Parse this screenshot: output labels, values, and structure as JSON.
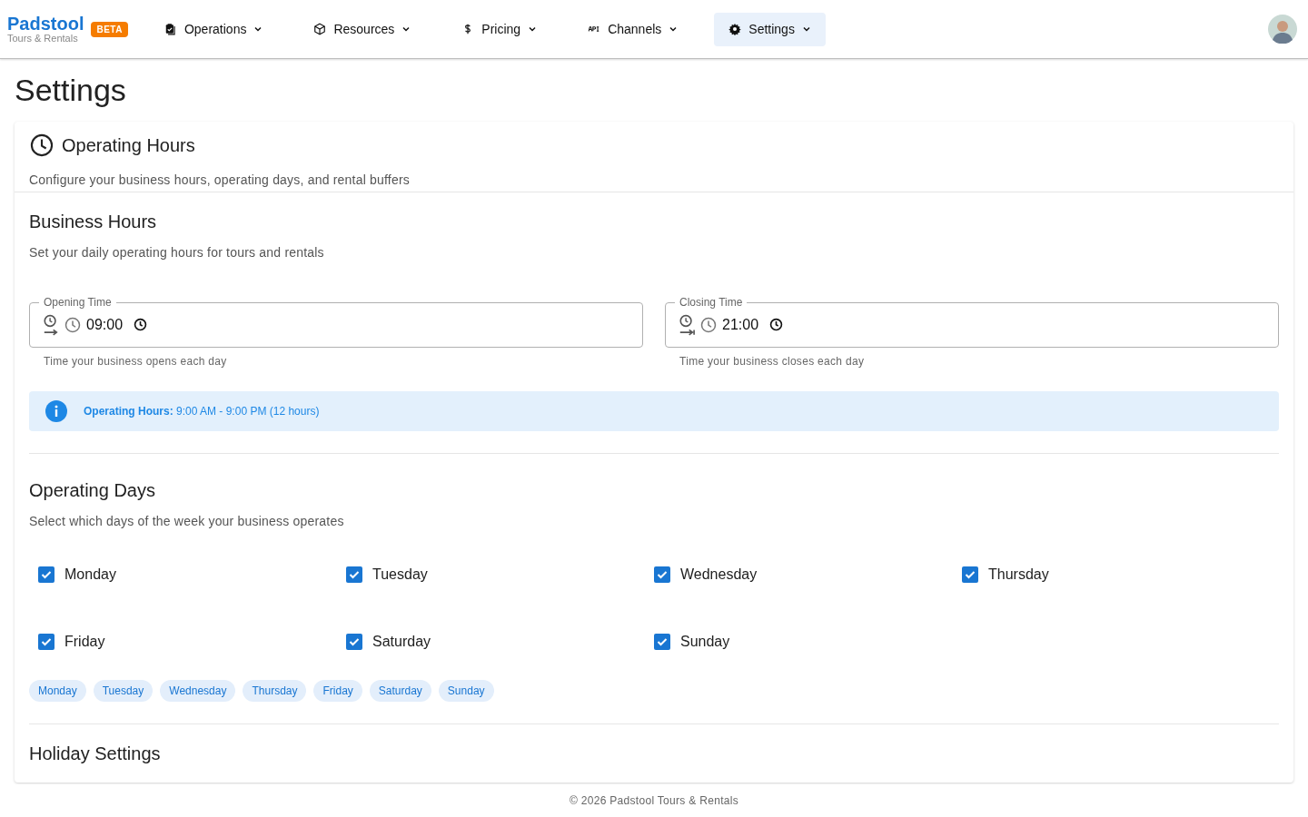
{
  "brand": {
    "name": "Padstool",
    "tagline": "Tours & Rentals",
    "badge": "BETA"
  },
  "nav": [
    {
      "label": "Operations",
      "selected": false
    },
    {
      "label": "Resources",
      "selected": false
    },
    {
      "label": "Pricing",
      "selected": false
    },
    {
      "label": "Channels",
      "selected": false
    },
    {
      "label": "Settings",
      "selected": true
    }
  ],
  "page_title": "Settings",
  "card": {
    "title": "Operating Hours",
    "subtitle": "Configure your business hours, operating days, and rental buffers"
  },
  "business_hours": {
    "title": "Business Hours",
    "subtitle": "Set your daily operating hours for tours and rentals",
    "fields": [
      {
        "kind": "open",
        "label": "Opening Time",
        "value": "09:00",
        "helper": "Time your business opens each day"
      },
      {
        "kind": "close",
        "label": "Closing Time",
        "value": "21:00",
        "helper": "Time your business closes each day"
      }
    ],
    "info": {
      "label": "Operating Hours:",
      "text": "9:00 AM - 9:00 PM (12 hours)"
    }
  },
  "operating_days": {
    "title": "Operating Days",
    "subtitle": "Select which days of the week your business operates",
    "days": [
      {
        "label": "Monday",
        "checked": true
      },
      {
        "label": "Tuesday",
        "checked": true
      },
      {
        "label": "Wednesday",
        "checked": true
      },
      {
        "label": "Thursday",
        "checked": true
      },
      {
        "label": "Friday",
        "checked": true
      },
      {
        "label": "Saturday",
        "checked": true
      },
      {
        "label": "Sunday",
        "checked": true
      }
    ],
    "chips": [
      "Monday",
      "Tuesday",
      "Wednesday",
      "Thursday",
      "Friday",
      "Saturday",
      "Sunday"
    ]
  },
  "next_section": {
    "title": "Holiday Settings"
  },
  "footer": "© 2026 Padstool Tours & Rentals"
}
